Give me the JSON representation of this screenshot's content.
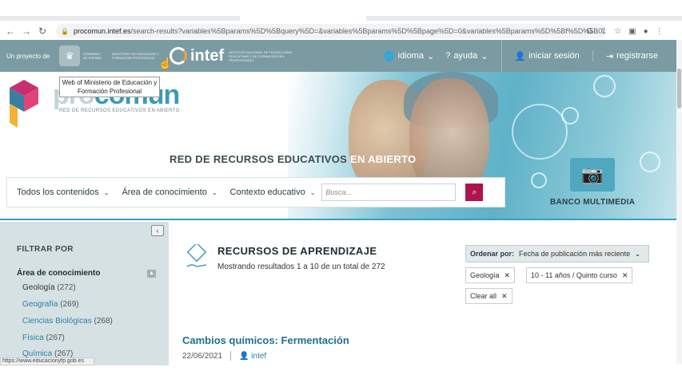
{
  "browser": {
    "url_host": "procomun.intef.es",
    "url_path": "/search-results?variables%5Bparams%5D%5Bquery%5D=&variables%5Bparams%5D%5Bpage%5D=0&variables%5Bparams%5D%5Bf%5D%5B0..."
  },
  "site_bar": {
    "proyecto": "Un proyecto de",
    "gobierno": "GOBIERNO DE ESPAÑA",
    "ministerio": "MINISTERIO DE EDUCACIÓN Y FORMACIÓN PROFESIONAL",
    "intef_word": "intef",
    "intef_full": "INSTITUTO NACIONAL DE TECNOLOGÍAS EDUCATIVAS Y DE FORMACIÓN DEL PROFESORADO",
    "idioma": "idioma",
    "ayuda": "ayuda",
    "login": "iniciar sesión",
    "register": "registrarse"
  },
  "tooltip": "Web of Ministerio de Educación y Formación Profesional",
  "hero": {
    "logo_pro": "pro",
    "logo_comun": "comun",
    "logo_sub": "RED DE RECURSOS EDUCATIVOS EN ABIERTO",
    "title_a": "RED DE RECURSOS EDUCATIVOS ",
    "title_b": "EN ABIERTO",
    "banco": "BANCO MULTIMEDIA"
  },
  "filters": {
    "contenidos": "Todos los contenidos",
    "area": "Área de conocimiento",
    "contexto": "Contexto educativo",
    "search_placeholder": "Busca..."
  },
  "sidebar": {
    "filtrar": "FILTRAR POR",
    "area_heading": "Área de conocimiento",
    "categories": [
      {
        "name": "Geología",
        "count": "(272)"
      },
      {
        "name": "Geografía",
        "count": "(269)"
      },
      {
        "name": "Ciencias Biológicas",
        "count": "(268)"
      },
      {
        "name": "Física",
        "count": "(267)"
      },
      {
        "name": "Química",
        "count": "(267)"
      }
    ]
  },
  "main": {
    "title": "RECURSOS DE APRENDIZAJE",
    "count_text": "Mostrando resultados 1 a 10 de un total de 272",
    "sort_label": "Ordenar por:",
    "sort_value": "Fecha de publicación más reciente",
    "chips": [
      "Geología",
      "10 - 11 años / Quinto curso",
      "Clear all"
    ],
    "article_title": "Cambios químicos: Fermentación",
    "article_date": "22/06/2021",
    "article_user": "intef"
  },
  "status_url": "https://www.educacionyfp.gob.es",
  "colors": {
    "bar": "#7b9ba2",
    "accent": "#b0134d",
    "link": "#2a7fa8"
  }
}
